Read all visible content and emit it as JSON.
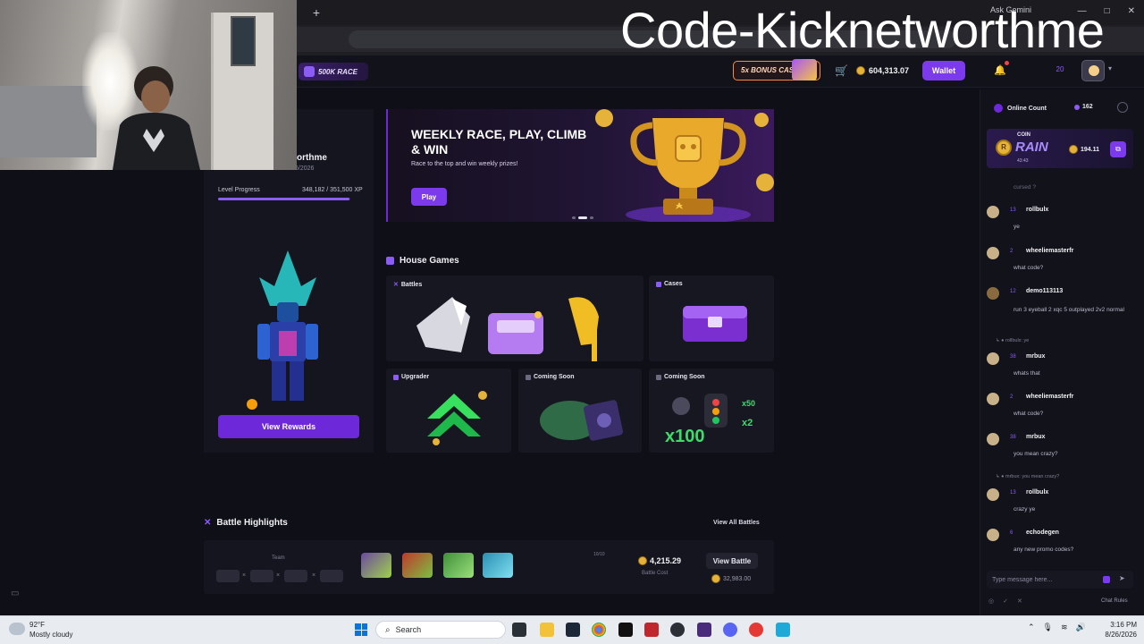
{
  "browser": {
    "new_tab_glyph": "+",
    "ask_gemini": "Ask Gemini",
    "window_controls": [
      "—",
      "□",
      "✕"
    ]
  },
  "overlay": {
    "text": "Code-Kicknetworthme"
  },
  "header": {
    "race_label": "500K RACE",
    "bonus_cases_label": "5x BONUS CASES",
    "balance": "604,313.07",
    "wallet_label": "Wallet",
    "level": "20"
  },
  "profile": {
    "name_suffix": "orthme",
    "joined": "Joined on 8/26/2026",
    "level_progress_label": "Level Progress",
    "xp_text": "348,182 / 351,500 XP",
    "xp_fraction": 0.99,
    "view_rewards_label": "View Rewards"
  },
  "race_banner": {
    "title": "WEEKLY RACE, PLAY, CLIMB & WIN",
    "subtitle": "Race to the top and win weekly prizes!",
    "play_label": "Play"
  },
  "house_games": {
    "title": "House Games",
    "tiles": [
      {
        "label": "Battles"
      },
      {
        "label": "Cases"
      },
      {
        "label": "Upgrader"
      },
      {
        "label": "Coming Soon"
      },
      {
        "label": "Coming Soon"
      }
    ]
  },
  "battle_highlights": {
    "title": "Battle Highlights",
    "view_all": "View All Battles",
    "team_label": "Team",
    "round_count": "10/10",
    "battle_cost": "4,215.29",
    "battle_cost_label": "Battle Cost",
    "view_battle_label": "View Battle",
    "win_amount": "32,983.00"
  },
  "chat": {
    "online_label": "Online Count",
    "online_count": "162",
    "rain": {
      "coin_label": "COIN",
      "rain_label": "RAIN",
      "timer": "43:43",
      "amount": "194.11"
    },
    "system_line": "cursed ?",
    "messages": [
      {
        "level": "13",
        "user": "rollbulx",
        "msg": "ye"
      },
      {
        "level": "2",
        "user": "wheeliemasterfr",
        "msg": "what code?"
      },
      {
        "level": "12",
        "user": "demo113113",
        "msg": "run 3 eyeball 2 xqc 5 outplayed 2v2 normal"
      },
      {
        "level": "38",
        "user": "mrbux",
        "msg": "whats that",
        "reply": "rollbulx: ye"
      },
      {
        "level": "2",
        "user": "wheeliemasterfr",
        "msg": "what code?"
      },
      {
        "level": "38",
        "user": "mrbux",
        "msg": "you mean crazy?"
      },
      {
        "level": "13",
        "user": "rollbulx",
        "msg": "crazy ye",
        "reply": "mrbux: you mean crazy?"
      },
      {
        "level": "6",
        "user": "echodegen",
        "msg": "any new promo codes?"
      }
    ],
    "input_placeholder": "Type message here...",
    "rules_label": "Chat Rules"
  },
  "taskbar": {
    "temperature": "92°F",
    "weather": "Mostly cloudy",
    "search_label": "Search",
    "time": "3:16 PM",
    "date": "8/26/2026"
  },
  "colors": {
    "accent": "#7c3aed",
    "background": "#0f0f17",
    "coin": "#e5b23a"
  }
}
